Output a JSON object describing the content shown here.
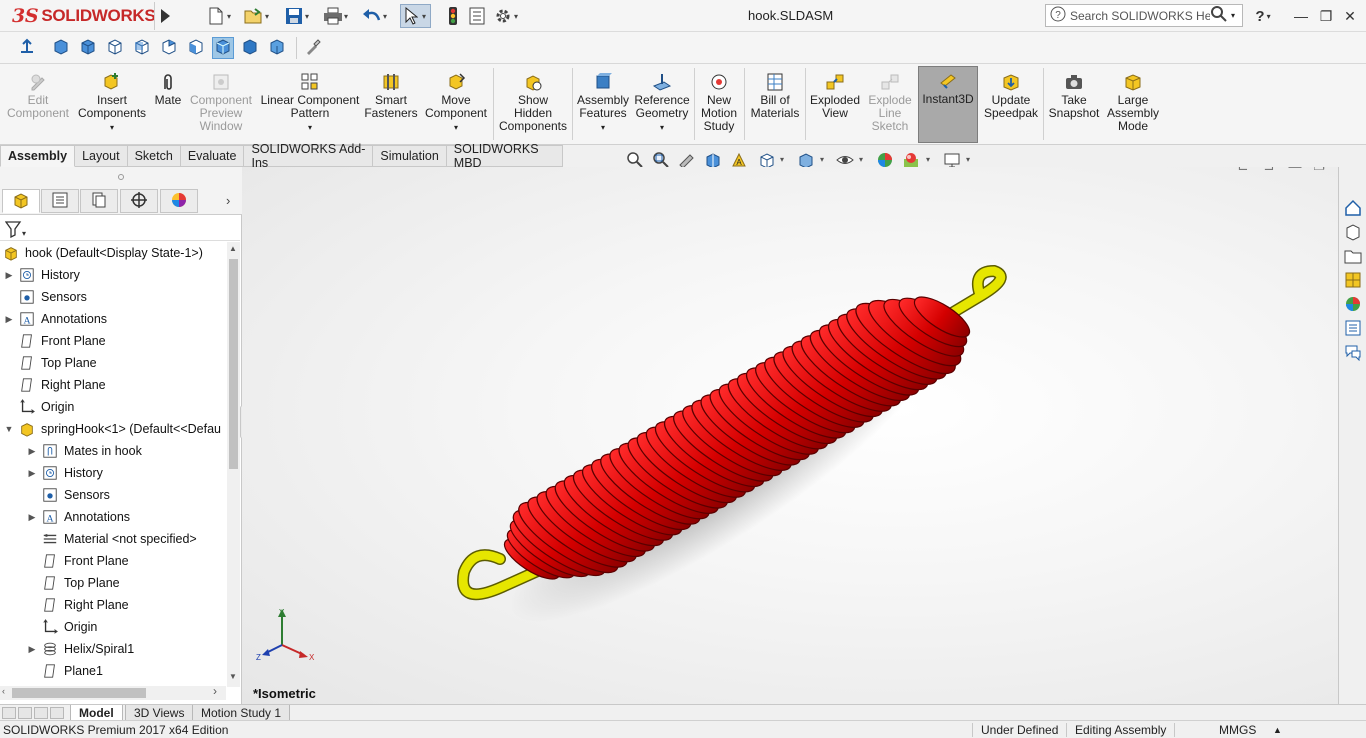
{
  "app": {
    "brand_prefix": "3S",
    "brand": "SOLIDWORKS",
    "document_title": "hook.SLDASM",
    "help_search_placeholder": "Search SOLIDWORKS Help",
    "colors": {
      "brand_red": "#c62828",
      "spring_red": "#d40000",
      "hook_yellow": "#e6e600",
      "highlight_blue": "#9ec7e6"
    }
  },
  "quick_access": [
    {
      "icon": "new-document-icon"
    },
    {
      "icon": "open-folder-icon"
    },
    {
      "icon": "save-icon"
    },
    {
      "icon": "print-icon"
    },
    {
      "icon": "undo-icon"
    },
    {
      "icon": "select-arrow-icon"
    },
    {
      "icon": "traffic-light-icon"
    },
    {
      "icon": "file-properties-icon"
    },
    {
      "icon": "options-gear-icon"
    }
  ],
  "command_manager": [
    {
      "label": "Edit\nComponent",
      "disabled": true
    },
    {
      "label": "Insert\nComponents",
      "dropdown": true
    },
    {
      "label": "Mate"
    },
    {
      "label": "Component\nPreview\nWindow",
      "disabled": true
    },
    {
      "label": "Linear Component\nPattern",
      "dropdown": true
    },
    {
      "label": "Smart\nFasteners"
    },
    {
      "label": "Move\nComponent",
      "dropdown": true
    },
    {
      "label": "Show\nHidden\nComponents"
    },
    {
      "label": "Assembly\nFeatures",
      "dropdown": true
    },
    {
      "label": "Reference\nGeometry",
      "dropdown": true
    },
    {
      "label": "New\nMotion\nStudy"
    },
    {
      "label": "Bill of\nMaterials"
    },
    {
      "label": "Exploded\nView"
    },
    {
      "label": "Explode\nLine\nSketch",
      "disabled": true
    },
    {
      "label": "Instant3D",
      "pressed": true
    },
    {
      "label": "Update\nSpeedpak"
    },
    {
      "label": "Take\nSnapshot"
    },
    {
      "label": "Large\nAssembly\nMode"
    }
  ],
  "tabs": [
    "Assembly",
    "Layout",
    "Sketch",
    "Evaluate",
    "SOLIDWORKS Add-Ins",
    "Simulation",
    "SOLIDWORKS MBD"
  ],
  "active_tab": "Assembly",
  "feature_tree": [
    {
      "label": "hook  (Default<Display State-1>)",
      "icon": "assembly-icon",
      "level": 0,
      "expand": ""
    },
    {
      "label": "History",
      "icon": "history-icon",
      "level": 1,
      "expand": "▶"
    },
    {
      "label": "Sensors",
      "icon": "sensor-icon",
      "level": 1,
      "expand": ""
    },
    {
      "label": "Annotations",
      "icon": "annotation-icon",
      "level": 1,
      "expand": "▶"
    },
    {
      "label": "Front Plane",
      "icon": "plane-icon",
      "level": 1,
      "expand": ""
    },
    {
      "label": "Top Plane",
      "icon": "plane-icon",
      "level": 1,
      "expand": ""
    },
    {
      "label": "Right Plane",
      "icon": "plane-icon",
      "level": 1,
      "expand": ""
    },
    {
      "label": "Origin",
      "icon": "origin-icon",
      "level": 1,
      "expand": ""
    },
    {
      "label": "springHook<1> (Default<<Defau",
      "icon": "part-icon",
      "level": 1,
      "expand": "▼"
    },
    {
      "label": "Mates in hook",
      "icon": "mates-icon",
      "level": 2,
      "expand": "▶"
    },
    {
      "label": "History",
      "icon": "history-icon",
      "level": 2,
      "expand": "▶"
    },
    {
      "label": "Sensors",
      "icon": "sensor-icon",
      "level": 2,
      "expand": ""
    },
    {
      "label": "Annotations",
      "icon": "annotation-icon",
      "level": 2,
      "expand": "▶"
    },
    {
      "label": "Material <not specified>",
      "icon": "material-icon",
      "level": 2,
      "expand": ""
    },
    {
      "label": "Front Plane",
      "icon": "plane-icon",
      "level": 2,
      "expand": ""
    },
    {
      "label": "Top Plane",
      "icon": "plane-icon",
      "level": 2,
      "expand": ""
    },
    {
      "label": "Right Plane",
      "icon": "plane-icon",
      "level": 2,
      "expand": ""
    },
    {
      "label": "Origin",
      "icon": "origin-icon",
      "level": 2,
      "expand": ""
    },
    {
      "label": "Helix/Spiral1",
      "icon": "helix-icon",
      "level": 2,
      "expand": "▶"
    },
    {
      "label": "Plane1",
      "icon": "plane-icon",
      "level": 2,
      "expand": ""
    }
  ],
  "viewport": {
    "view_label": "*Isometric",
    "triad": {
      "x": "X",
      "y": "Y",
      "z": "Z"
    }
  },
  "bottom_tabs": [
    "Model",
    "3D Views",
    "Motion Study 1"
  ],
  "active_bottom_tab": "Model",
  "status": {
    "edition": "SOLIDWORKS Premium 2017 x64 Edition",
    "definition": "Under Defined",
    "mode": "Editing Assembly",
    "units": "MMGS",
    "units_arrow": "▲"
  }
}
